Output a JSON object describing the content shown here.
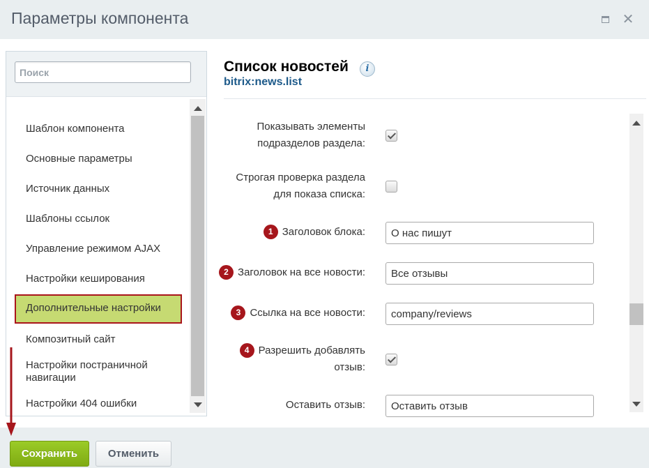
{
  "window": {
    "title": "Параметры компонента"
  },
  "search": {
    "placeholder": "Поиск"
  },
  "sidebar": {
    "items": [
      {
        "label": "Шаблон компонента"
      },
      {
        "label": "Основные параметры"
      },
      {
        "label": "Источник данных"
      },
      {
        "label": "Шаблоны ссылок"
      },
      {
        "label": "Управление режимом AJAX"
      },
      {
        "label": "Настройки кеширования"
      },
      {
        "label": "Дополнительные настройки",
        "active": true
      },
      {
        "label": "Композитный сайт"
      },
      {
        "label": "Настройки постраничной навигации"
      },
      {
        "label": "Настройки 404 ошибки"
      }
    ]
  },
  "component": {
    "title": "Список новостей",
    "code": "bitrix:news.list",
    "info_glyph": "i"
  },
  "params": [
    {
      "label_line1": "Показывать элементы",
      "label_line2": "подразделов раздела:",
      "type": "checkbox",
      "checked": true
    },
    {
      "label_line1": "Строгая проверка раздела",
      "label_line2": "для показа списка:",
      "type": "checkbox",
      "checked": false
    },
    {
      "badge": "1",
      "label": "Заголовок блока:",
      "type": "text",
      "value": "О нас пишут"
    },
    {
      "badge": "2",
      "label": "Заголовок на все новости:",
      "type": "text",
      "value": "Все отзывы"
    },
    {
      "badge": "3",
      "label": "Ссылка на все новости:",
      "type": "text",
      "value": "company/reviews"
    },
    {
      "badge": "4",
      "label_line1": "Разрешить добавлять",
      "label_line2": "отзыв:",
      "type": "checkbox",
      "checked": true
    },
    {
      "label": "Оставить отзыв:",
      "type": "text",
      "value": "Оставить отзыв"
    }
  ],
  "footer": {
    "save_label": "Сохранить",
    "cancel_label": "Отменить"
  },
  "colors": {
    "accent_green": "#8fbd1f",
    "active_item_bg": "#c6da72",
    "annotation_red": "#a6161c",
    "link_blue": "#1d5a8a"
  }
}
